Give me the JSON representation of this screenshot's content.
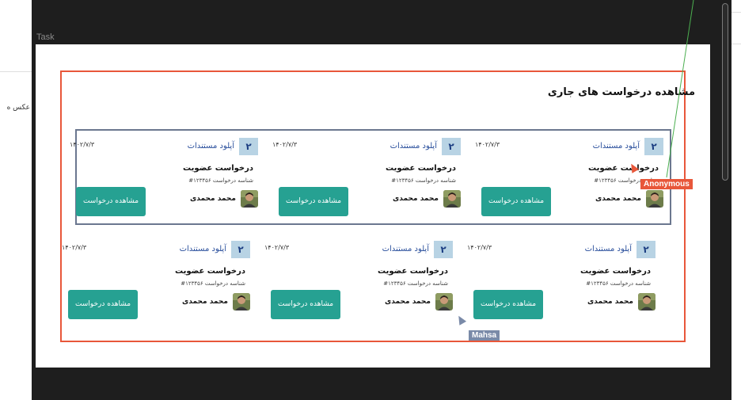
{
  "left_panel": {
    "partial_text": "عکس ه"
  },
  "frame": {
    "label": "Task"
  },
  "section": {
    "title": "مشاهده درخواست های جاری"
  },
  "cards": [
    {
      "badge": "۲",
      "badge_label": "آپلود مستندات",
      "date": "۱۴۰۲/۷/۳",
      "title": "درخواست عضویت",
      "subtitle": "شناسه درخواست ۱۲۳۴۵۶#",
      "name": "محمد محمدی",
      "button": "مشاهده درخواست"
    },
    {
      "badge": "۲",
      "badge_label": "آپلود مستندات",
      "date": "۱۴۰۲/۷/۳",
      "title": "درخواست عضویت",
      "subtitle": "شناسه درخواست ۱۲۳۴۵۶#",
      "name": "محمد محمدی",
      "button": "مشاهده درخواست"
    },
    {
      "badge": "۲",
      "badge_label": "آپلود مستندات",
      "date": "۱۴۰۲/۷/۳",
      "title": "درخواست عضویت",
      "subtitle": "شناسه درخواست ۱۲۳۴۵۶#",
      "name": "محمد محمدی",
      "button": "مشاهده درخواست"
    },
    {
      "badge": "۲",
      "badge_label": "آپلود مستندات",
      "date": "۱۴۰۲/۷/۳",
      "title": "درخواست عضویت",
      "subtitle": "شناسه درخواست ۱۲۳۴۵۶#",
      "name": "محمد محمدی",
      "button": "مشاهده درخواست"
    },
    {
      "badge": "۲",
      "badge_label": "آپلود مستندات",
      "date": "۱۴۰۲/۷/۳",
      "title": "درخواست عضویت",
      "subtitle": "شناسه درخواست ۱۲۳۴۵۶#",
      "name": "محمد محمدی",
      "button": "مشاهده درخواست"
    },
    {
      "badge": "۲",
      "badge_label": "آپلود مستندات",
      "date": "۱۴۰۲/۷/۳",
      "title": "درخواست عضویت",
      "subtitle": "شناسه درخواست ۱۲۳۴۵۶#",
      "name": "محمد محمدی",
      "button": "مشاهده درخواست"
    }
  ],
  "collaborators": [
    {
      "name": "Anonymous",
      "color": "#e8573a"
    },
    {
      "name": "Mahsa",
      "color": "#7a8aa8"
    }
  ],
  "colors": {
    "accent_button": "#26a192",
    "badge_bg": "#b8d3e4",
    "badge_text": "#1d3f83",
    "selection": "#e8573a",
    "group_outline": "#6b778f"
  },
  "icons": [
    "avatar-image",
    "cursor-icon"
  ]
}
